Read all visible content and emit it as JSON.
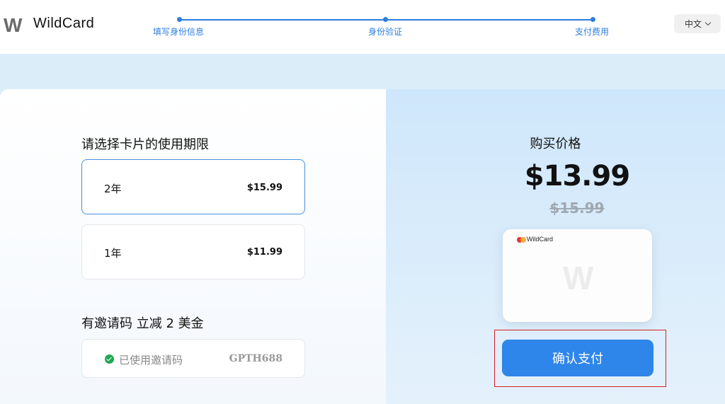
{
  "header": {
    "logo_mark": "W",
    "brand_name": "WildCard",
    "language_label": "中文"
  },
  "steps": [
    {
      "label": "填写身份信息"
    },
    {
      "label": "身份验证"
    },
    {
      "label": "支付费用"
    }
  ],
  "duration": {
    "title": "请选择卡片的使用期限",
    "options": [
      {
        "label": "2年",
        "price": "$15.99",
        "selected": true
      },
      {
        "label": "1年",
        "price": "$11.99",
        "selected": false
      }
    ]
  },
  "invite": {
    "title": "有邀请码 立减 2 美金",
    "status_label": "已使用邀请码",
    "code": "GPTH688"
  },
  "summary": {
    "title": "购买价格",
    "price_now": "$13.99",
    "price_old": "$15.99",
    "card_brand": "WildCard",
    "card_watermark": "W",
    "pay_button_label": "确认支付"
  },
  "colors": {
    "accent": "#2e86ea",
    "step": "#2e7de0",
    "success": "#1fa84f",
    "highlight": "#d6202a"
  }
}
